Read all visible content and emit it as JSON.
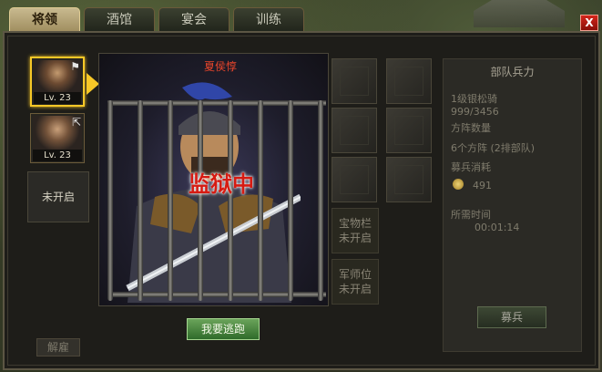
{
  "tabs": [
    {
      "label": "将领",
      "active": true
    },
    {
      "label": "酒馆",
      "active": false
    },
    {
      "label": "宴会",
      "active": false
    },
    {
      "label": "训练",
      "active": false
    }
  ],
  "close_label": "X",
  "heroes": [
    {
      "level": "Lv. 23",
      "selected": true,
      "mark_icon": "flag-icon"
    },
    {
      "level": "Lv. 23",
      "selected": false,
      "mark_icon": "arrow-icon"
    }
  ],
  "locked_slot_label": "未开启",
  "dismiss_label": "解雇",
  "hero_name": "夏侯惇",
  "status_text": "监狱中",
  "escape_label": "我要逃跑",
  "slots": {
    "treasure": {
      "line1": "宝物栏",
      "line2": "未开启"
    },
    "advisor": {
      "line1": "军师位",
      "line2": "未开启"
    }
  },
  "troops": {
    "title": "部队兵力",
    "unit_name": "1级银松骑",
    "count": "999/3456",
    "formation_label": "方阵数量",
    "formation_value": "6个方阵 (2排部队)",
    "cost_label": "募兵消耗",
    "cost_value": "491",
    "time_label": "所需时间",
    "time_value": "00:01:14",
    "recruit_label": "募兵"
  },
  "colors": {
    "accent_gold": "#f7c827",
    "status_red": "#d61b12",
    "name_red": "#e8452b",
    "escape_green": "#4f8a44"
  }
}
